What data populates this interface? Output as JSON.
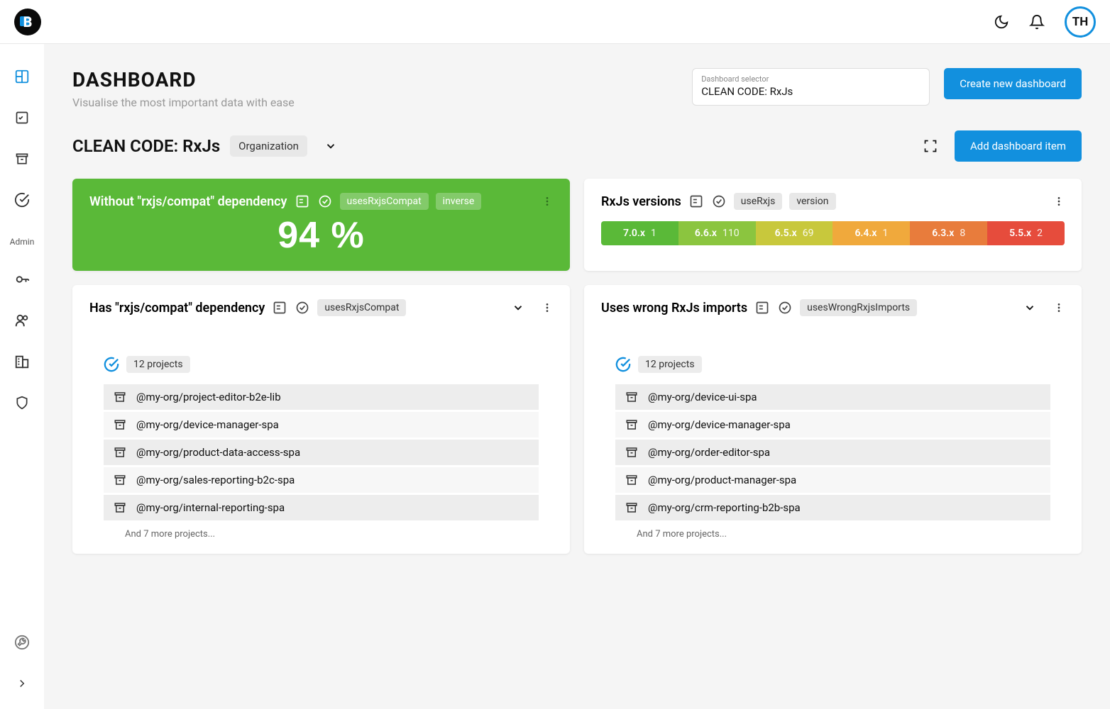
{
  "topbar": {
    "logo_letter": "B",
    "avatar_initials": "TH"
  },
  "sidebar": {
    "admin_label": "Admin"
  },
  "page": {
    "title": "DASHBOARD",
    "subtitle": "Visualise the most important data with ease",
    "selector_label": "Dashboard selector",
    "selector_value": "CLEAN CODE: RxJs",
    "create_btn": "Create new dashboard",
    "dash_title": "CLEAN CODE: RxJs",
    "scope_chip": "Organization",
    "add_item_btn": "Add dashboard item"
  },
  "cards": {
    "green": {
      "title": "Without \"rxjs/compat\" dependency",
      "tags": [
        "usesRxjsCompat",
        "inverse"
      ],
      "value": "94 %"
    },
    "versions": {
      "title": "RxJs versions",
      "tags": [
        "useRxjs",
        "version"
      ],
      "segments": [
        {
          "label": "7.0.x",
          "count": "1",
          "color": "#5ab938"
        },
        {
          "label": "6.6.x",
          "count": "110",
          "color": "#8bc53f"
        },
        {
          "label": "6.5.x",
          "count": "69",
          "color": "#c8c83c"
        },
        {
          "label": "6.4.x",
          "count": "1",
          "color": "#f0a93c"
        },
        {
          "label": "6.3.x",
          "count": "8",
          "color": "#e87c3c"
        },
        {
          "label": "5.5.x",
          "count": "2",
          "color": "#e64c3c"
        }
      ]
    },
    "compat": {
      "title": "Has \"rxjs/compat\" dependency",
      "tags": [
        "usesRxjsCompat"
      ],
      "count_label": "12 projects",
      "items": [
        "@my-org/project-editor-b2e-lib",
        "@my-org/device-manager-spa",
        "@my-org/product-data-access-spa",
        "@my-org/sales-reporting-b2c-spa",
        "@my-org/internal-reporting-spa"
      ],
      "more": "And 7 more projects..."
    },
    "wrong": {
      "title": "Uses wrong RxJs imports",
      "tags": [
        "usesWrongRxjsImports"
      ],
      "count_label": "12 projects",
      "items": [
        "@my-org/device-ui-spa",
        "@my-org/device-manager-spa",
        "@my-org/order-editor-spa",
        "@my-org/product-manager-spa",
        "@my-org/crm-reporting-b2b-spa"
      ],
      "more": "And 7 more projects..."
    }
  }
}
